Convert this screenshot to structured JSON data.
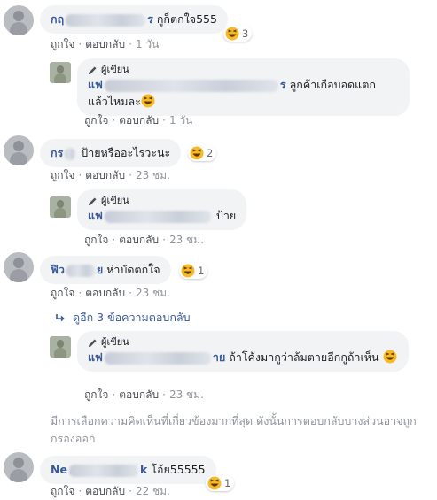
{
  "labels": {
    "like": "ถูกใจ",
    "reply": "ตอบกลับ",
    "sep": "·",
    "author_badge": "ผู้เขียน"
  },
  "comments": [
    {
      "name_start": "กฤ",
      "name_end": "ร",
      "text": "กูก็ตกใจ555",
      "reaction_count": "3",
      "time": "1 วัน"
    },
    {
      "name_start": "แฟ",
      "name_end": "ร",
      "text": "ลูกค้าเกือบอดแตก แล้วไหมละ",
      "time": "1 วัน",
      "author": true
    },
    {
      "name_start": "กร",
      "name_end": "",
      "text": "ป้ายหรืออะไรวะนะ",
      "reaction_count": "2",
      "time": "23 ชม."
    },
    {
      "name_start": "แฟ",
      "name_end": "",
      "text": "ป้าย",
      "time": "23 ชม.",
      "author": true
    },
    {
      "name_start": "ฟิว",
      "name_end": "ย",
      "text": "ห่าบัดตกใจ",
      "reaction_count": "1",
      "time": "23 ชม."
    },
    {
      "name_start": "แฟ",
      "name_end": "าย",
      "text": "ถ้าโค้งมากูว่าล้มตายอีกกูถ้าเห็น",
      "time": "23 ชม.",
      "author": true
    },
    {
      "name_start": "Ne",
      "name_end": "k",
      "text": "โอ้ย55555",
      "reaction_count": "1",
      "time": "22 ชม."
    }
  ],
  "more_replies": "ดูอีก 3 ข้อความตอบกลับ",
  "notice": "มีการเลือกความคิดเห็นที่เกี่ยวข้องมากที่สุด ดังนั้นการตอบกลับบางส่วนอาจถูกกรองออก",
  "colors": {
    "name": "#385898",
    "bubble": "#f2f3f5",
    "meta": "#90949c"
  },
  "icons": {
    "reaction": "laughing-emoji",
    "badge": "pencil-icon",
    "reply_arrow": "reply-arrow-icon"
  }
}
